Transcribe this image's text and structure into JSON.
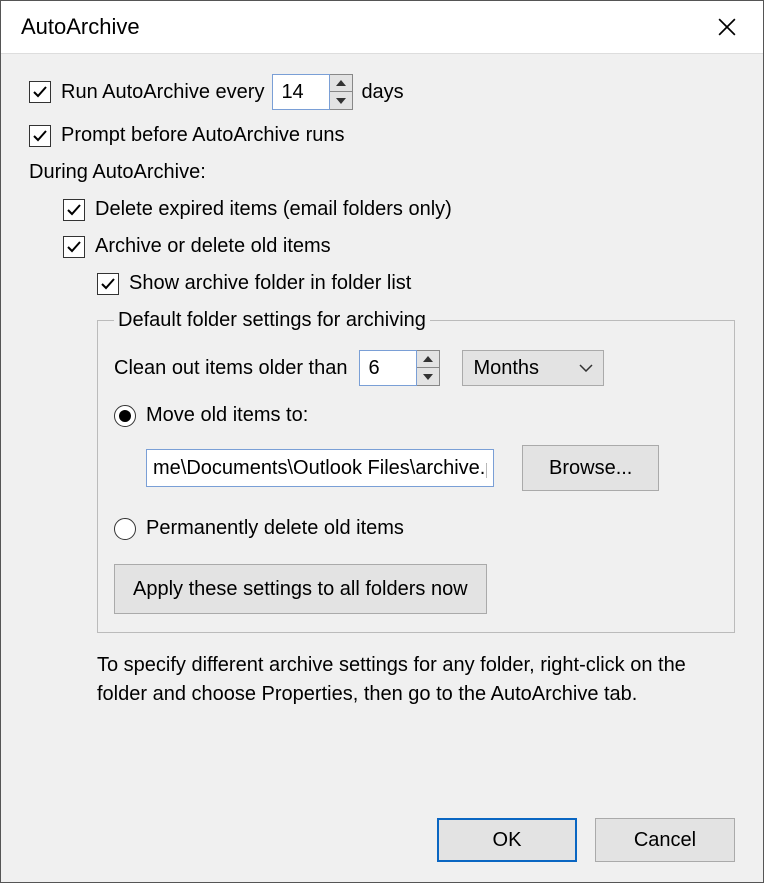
{
  "title": "AutoArchive",
  "run_every": {
    "checked": true,
    "label_before": "Run AutoArchive every",
    "value": "14",
    "label_after": "days"
  },
  "prompt": {
    "checked": true,
    "label": "Prompt before AutoArchive runs"
  },
  "during_label": "During AutoArchive:",
  "delete_expired": {
    "checked": true,
    "label": "Delete expired items (email folders only)"
  },
  "archive_delete": {
    "checked": true,
    "label": "Archive or delete old items"
  },
  "show_folder": {
    "checked": true,
    "label": "Show archive folder in folder list"
  },
  "group": {
    "legend": "Default folder settings for archiving",
    "clean_label": "Clean out items older than",
    "clean_value": "6",
    "unit_selected": "Months",
    "move": {
      "selected": true,
      "label": "Move old items to:",
      "path": "me\\Documents\\Outlook Files\\archive.pst",
      "browse": "Browse..."
    },
    "perm_delete": {
      "selected": false,
      "label": "Permanently delete old items"
    },
    "apply_label": "Apply these settings to all folders now"
  },
  "note_text": "To specify different archive settings for any folder, right-click on the folder and choose Properties, then go to the AutoArchive tab.",
  "buttons": {
    "ok": "OK",
    "cancel": "Cancel"
  }
}
